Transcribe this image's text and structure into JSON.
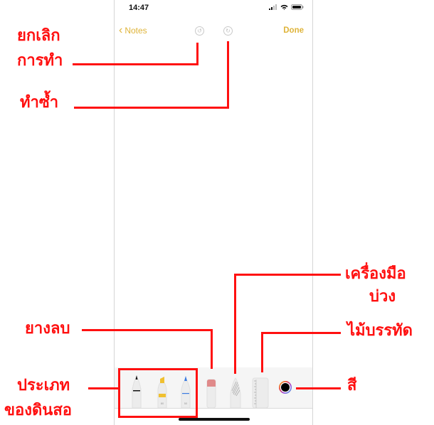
{
  "status_bar": {
    "time": "14:47",
    "icons": [
      "signal-icon",
      "wifi-icon",
      "battery-icon"
    ]
  },
  "nav": {
    "back_label": "Notes",
    "done_label": "Done",
    "undo_icon": "undo-icon",
    "redo_icon": "redo-icon"
  },
  "toolbar": {
    "tools": [
      {
        "name": "pen",
        "icon": "pen-icon",
        "color": "#111111"
      },
      {
        "name": "marker",
        "icon": "marker-icon",
        "color": "#f0c030",
        "size_label": "80"
      },
      {
        "name": "pencil",
        "icon": "pencil-icon",
        "color": "#3a7be0",
        "size_label": "50"
      },
      {
        "name": "eraser",
        "icon": "eraser-icon",
        "color": "#e08a8a"
      },
      {
        "name": "lasso",
        "icon": "lasso-icon"
      },
      {
        "name": "ruler",
        "icon": "ruler-icon"
      }
    ],
    "color_picker": {
      "icon": "color-wheel-icon",
      "selected_color": "#000000"
    }
  },
  "annotations": {
    "undo": "ยกเลิก\nการทำ",
    "undo_line1": "ยกเลิก",
    "undo_line2": "การทำ",
    "redo": "ทำซ้ำ",
    "eraser": "ยางลบ",
    "pencil_types_line1": "ประเภท",
    "pencil_types_line2": "ของดินสอ",
    "lasso_line1": "เครื่องมือ",
    "lasso_line2": "บ่วง",
    "ruler": "ไม้บรรทัด",
    "color": "สี"
  },
  "colors": {
    "accent": "#dfb43a",
    "annotation": "#ff1010"
  }
}
